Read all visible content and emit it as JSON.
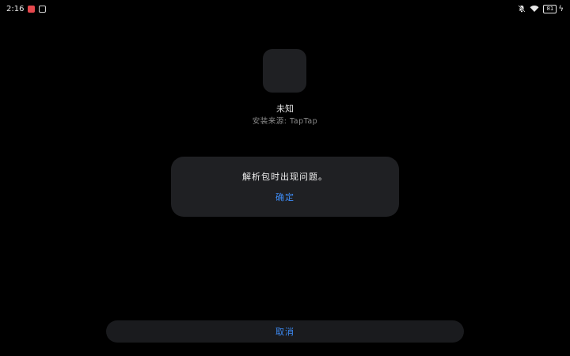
{
  "status_bar": {
    "time": "2:16",
    "battery": "81"
  },
  "app": {
    "name": "未知",
    "source": "安装来源: TapTap"
  },
  "dialog": {
    "message": "解析包时出现问题。",
    "confirm_label": "确定"
  },
  "footer": {
    "cancel_label": "取消"
  },
  "colors": {
    "accent": "#3d8bf5",
    "panel": "#1f2023",
    "background": "#000000"
  }
}
